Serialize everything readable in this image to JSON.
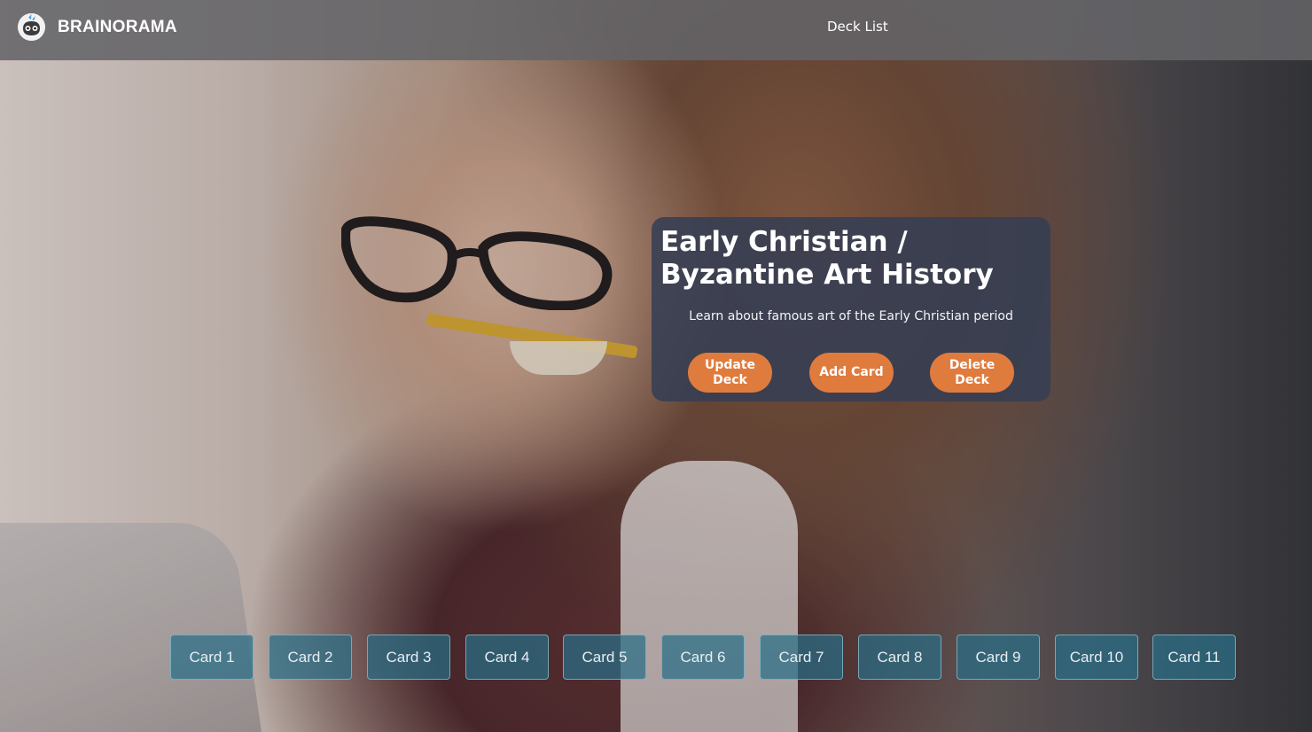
{
  "navbar": {
    "brand_name": "BRAINORAMA",
    "logo_icon": "brain-mascot-icon",
    "links": [
      {
        "label": "Deck List"
      }
    ]
  },
  "deck": {
    "title": "Early Christian / Byzantine Art History",
    "description": "Learn about famous art of the Early Christian period",
    "buttons": {
      "update_label": "Update Deck",
      "add_label": "Add Card",
      "delete_label": "Delete Deck"
    }
  },
  "cards": [
    {
      "label": "Card 1"
    },
    {
      "label": "Card 2"
    },
    {
      "label": "Card 3"
    },
    {
      "label": "Card 4"
    },
    {
      "label": "Card 5"
    },
    {
      "label": "Card 6"
    },
    {
      "label": "Card 7"
    },
    {
      "label": "Card 8"
    },
    {
      "label": "Card 9"
    },
    {
      "label": "Card 10"
    },
    {
      "label": "Card 11"
    }
  ],
  "colors": {
    "accent": "#e07b3e",
    "card": "#286e87",
    "panel": "#343e54",
    "navbar": "#646468"
  }
}
